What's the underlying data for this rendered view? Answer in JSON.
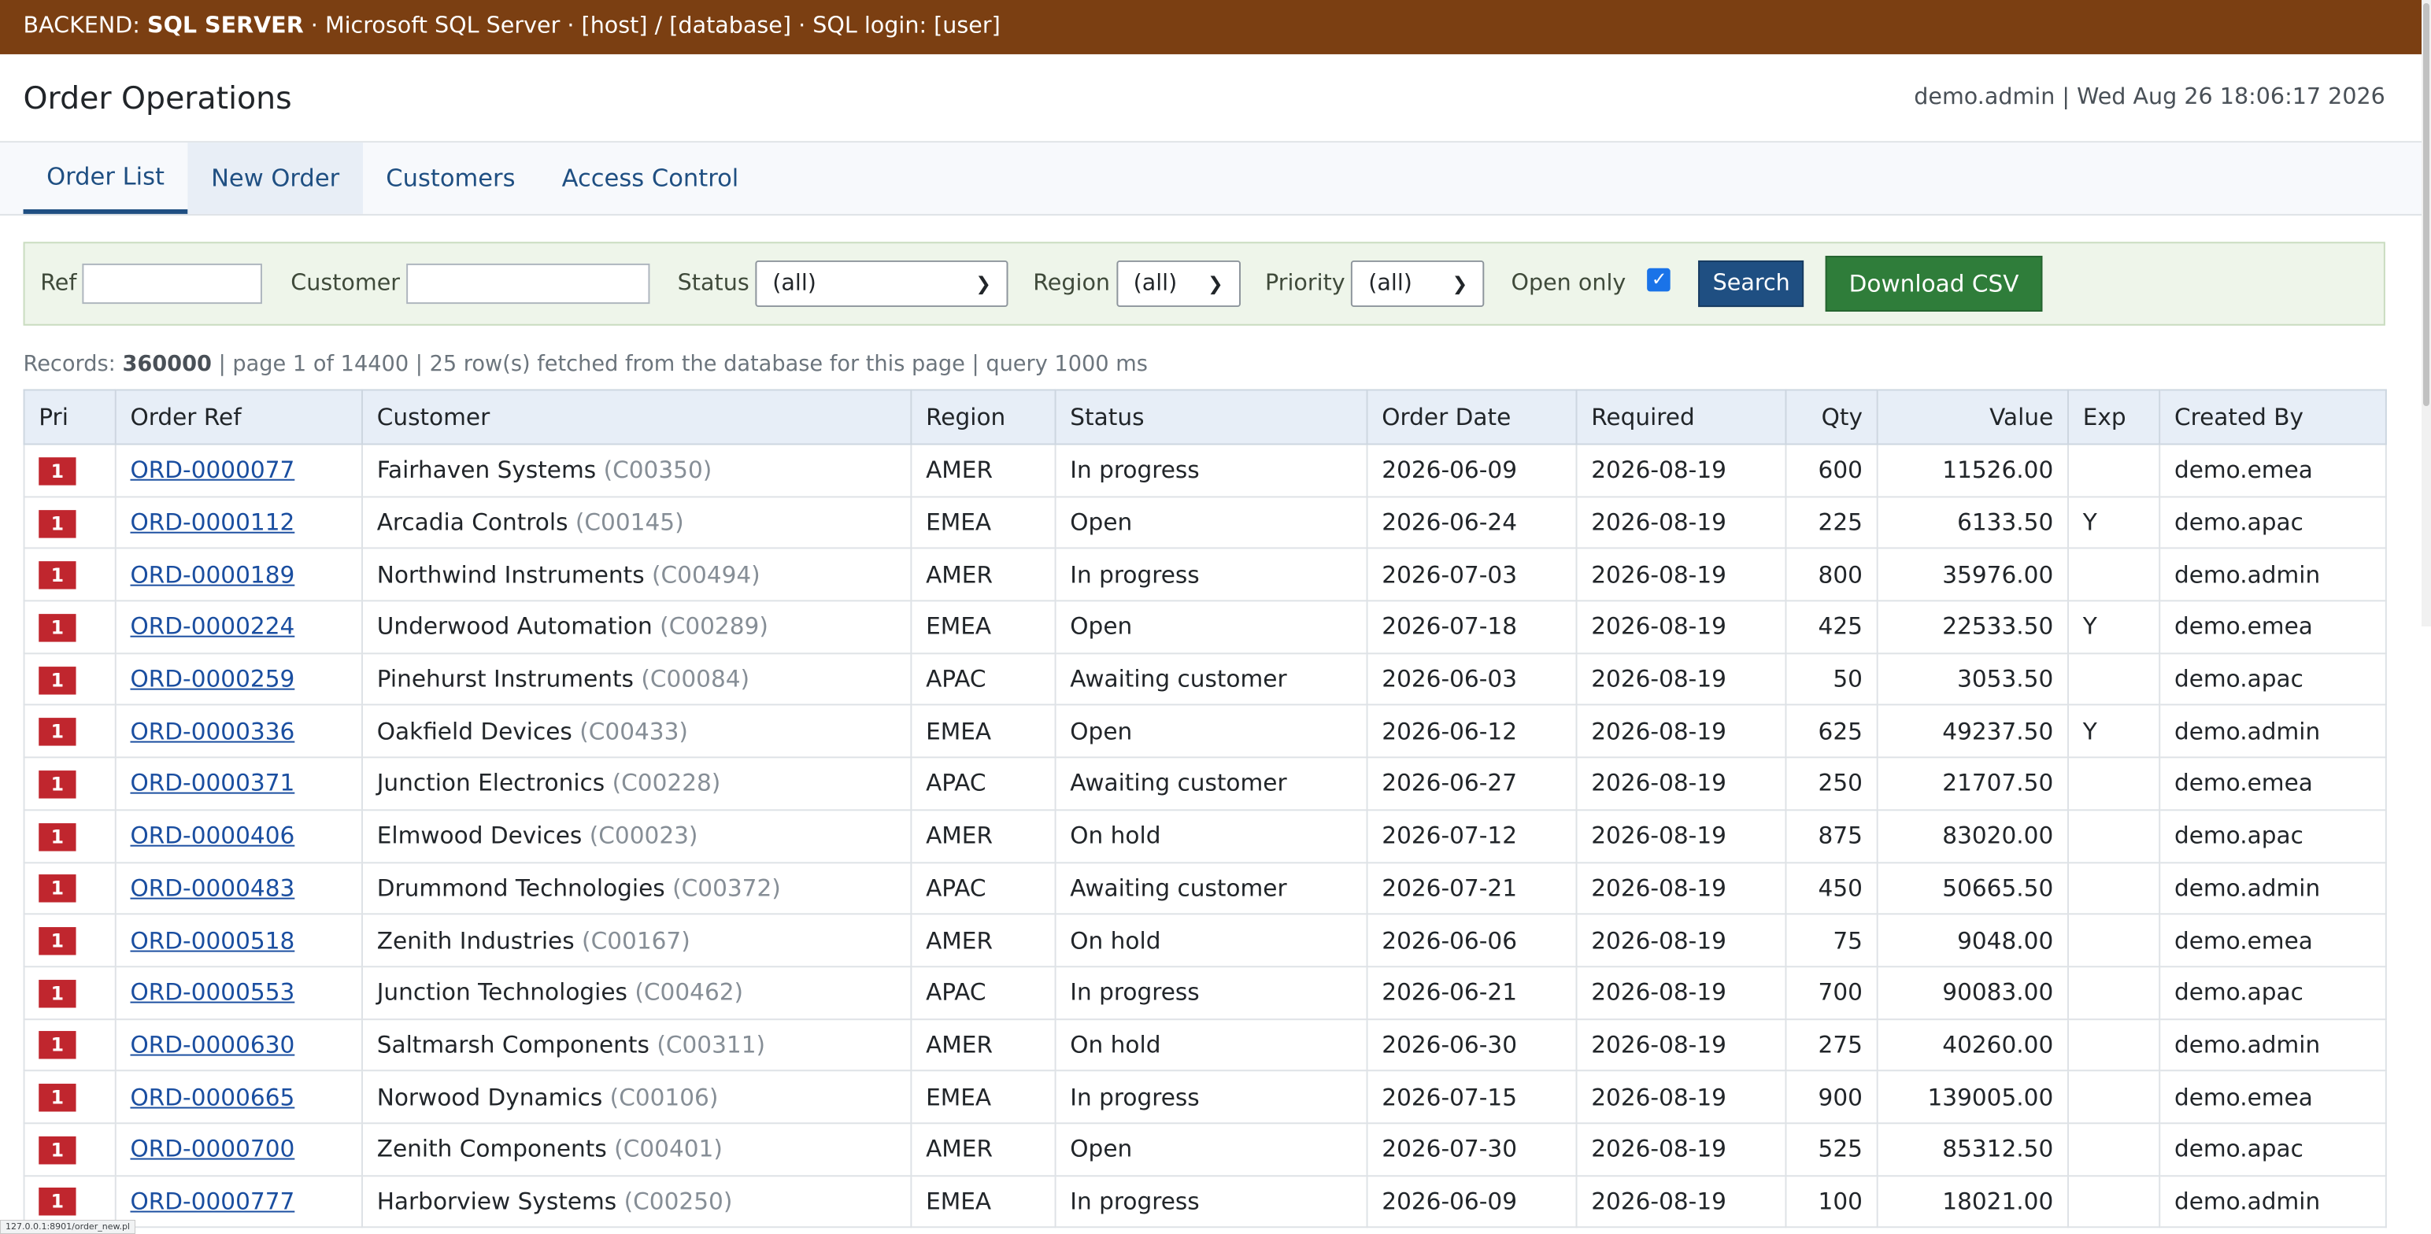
{
  "banner": {
    "prefix": "BACKEND: ",
    "backend": "SQL SERVER",
    "details": " · Microsoft SQL Server · [host] / [database] · SQL login: [user]"
  },
  "header": {
    "title": "Order Operations",
    "user_info": "demo.admin | Wed Aug 26 18:06:17 2026"
  },
  "tabs": [
    {
      "label": "Order List",
      "active": true
    },
    {
      "label": "New Order"
    },
    {
      "label": "Customers"
    },
    {
      "label": "Access Control"
    }
  ],
  "filters": {
    "ref_label": "Ref",
    "ref_value": "",
    "customer_label": "Customer",
    "customer_value": "",
    "status_label": "Status",
    "status_value": "(all)",
    "region_label": "Region",
    "region_value": "(all)",
    "priority_label": "Priority",
    "priority_value": "(all)",
    "open_only_label": "Open only",
    "open_only_checked": true,
    "search_label": "Search",
    "csv_label": "Download CSV"
  },
  "stats": {
    "records_label": "Records: ",
    "records": "360000",
    "rest": " | page 1 of 14400 | 25 row(s) fetched from the database for this page | query 1000 ms"
  },
  "table": {
    "columns": [
      "Pri",
      "Order Ref",
      "Customer",
      "Region",
      "Status",
      "Order Date",
      "Required",
      "Qty",
      "Value",
      "Exp",
      "Created By"
    ],
    "rows": [
      {
        "pri": "1",
        "ref": "ORD-0000077",
        "customer": "Fairhaven Systems",
        "cid": "(C00350)",
        "region": "AMER",
        "status": "In progress",
        "order_date": "2026-06-09",
        "required": "2026-08-19",
        "qty": "600",
        "value": "11526.00",
        "exp": "",
        "created_by": "demo.emea"
      },
      {
        "pri": "1",
        "ref": "ORD-0000112",
        "customer": "Arcadia Controls",
        "cid": "(C00145)",
        "region": "EMEA",
        "status": "Open",
        "order_date": "2026-06-24",
        "required": "2026-08-19",
        "qty": "225",
        "value": "6133.50",
        "exp": "Y",
        "created_by": "demo.apac"
      },
      {
        "pri": "1",
        "ref": "ORD-0000189",
        "customer": "Northwind Instruments",
        "cid": "(C00494)",
        "region": "AMER",
        "status": "In progress",
        "order_date": "2026-07-03",
        "required": "2026-08-19",
        "qty": "800",
        "value": "35976.00",
        "exp": "",
        "created_by": "demo.admin"
      },
      {
        "pri": "1",
        "ref": "ORD-0000224",
        "customer": "Underwood Automation",
        "cid": "(C00289)",
        "region": "EMEA",
        "status": "Open",
        "order_date": "2026-07-18",
        "required": "2026-08-19",
        "qty": "425",
        "value": "22533.50",
        "exp": "Y",
        "created_by": "demo.emea"
      },
      {
        "pri": "1",
        "ref": "ORD-0000259",
        "customer": "Pinehurst Instruments",
        "cid": "(C00084)",
        "region": "APAC",
        "status": "Awaiting customer",
        "order_date": "2026-06-03",
        "required": "2026-08-19",
        "qty": "50",
        "value": "3053.50",
        "exp": "",
        "created_by": "demo.apac"
      },
      {
        "pri": "1",
        "ref": "ORD-0000336",
        "customer": "Oakfield Devices",
        "cid": "(C00433)",
        "region": "EMEA",
        "status": "Open",
        "order_date": "2026-06-12",
        "required": "2026-08-19",
        "qty": "625",
        "value": "49237.50",
        "exp": "Y",
        "created_by": "demo.admin"
      },
      {
        "pri": "1",
        "ref": "ORD-0000371",
        "customer": "Junction Electronics",
        "cid": "(C00228)",
        "region": "APAC",
        "status": "Awaiting customer",
        "order_date": "2026-06-27",
        "required": "2026-08-19",
        "qty": "250",
        "value": "21707.50",
        "exp": "",
        "created_by": "demo.emea"
      },
      {
        "pri": "1",
        "ref": "ORD-0000406",
        "customer": "Elmwood Devices",
        "cid": "(C00023)",
        "region": "AMER",
        "status": "On hold",
        "order_date": "2026-07-12",
        "required": "2026-08-19",
        "qty": "875",
        "value": "83020.00",
        "exp": "",
        "created_by": "demo.apac"
      },
      {
        "pri": "1",
        "ref": "ORD-0000483",
        "customer": "Drummond Technologies",
        "cid": "(C00372)",
        "region": "APAC",
        "status": "Awaiting customer",
        "order_date": "2026-07-21",
        "required": "2026-08-19",
        "qty": "450",
        "value": "50665.50",
        "exp": "",
        "created_by": "demo.admin"
      },
      {
        "pri": "1",
        "ref": "ORD-0000518",
        "customer": "Zenith Industries",
        "cid": "(C00167)",
        "region": "AMER",
        "status": "On hold",
        "order_date": "2026-06-06",
        "required": "2026-08-19",
        "qty": "75",
        "value": "9048.00",
        "exp": "",
        "created_by": "demo.emea"
      },
      {
        "pri": "1",
        "ref": "ORD-0000553",
        "customer": "Junction Technologies",
        "cid": "(C00462)",
        "region": "APAC",
        "status": "In progress",
        "order_date": "2026-06-21",
        "required": "2026-08-19",
        "qty": "700",
        "value": "90083.00",
        "exp": "",
        "created_by": "demo.apac"
      },
      {
        "pri": "1",
        "ref": "ORD-0000630",
        "customer": "Saltmarsh Components",
        "cid": "(C00311)",
        "region": "AMER",
        "status": "On hold",
        "order_date": "2026-06-30",
        "required": "2026-08-19",
        "qty": "275",
        "value": "40260.00",
        "exp": "",
        "created_by": "demo.admin"
      },
      {
        "pri": "1",
        "ref": "ORD-0000665",
        "customer": "Norwood Dynamics",
        "cid": "(C00106)",
        "region": "EMEA",
        "status": "In progress",
        "order_date": "2026-07-15",
        "required": "2026-08-19",
        "qty": "900",
        "value": "139005.00",
        "exp": "",
        "created_by": "demo.emea"
      },
      {
        "pri": "1",
        "ref": "ORD-0000700",
        "customer": "Zenith Components",
        "cid": "(C00401)",
        "region": "AMER",
        "status": "Open",
        "order_date": "2026-07-30",
        "required": "2026-08-19",
        "qty": "525",
        "value": "85312.50",
        "exp": "",
        "created_by": "demo.apac"
      },
      {
        "pri": "1",
        "ref": "ORD-0000777",
        "customer": "Harborview Systems",
        "cid": "(C00250)",
        "region": "EMEA",
        "status": "In progress",
        "order_date": "2026-06-09",
        "required": "2026-08-19",
        "qty": "100",
        "value": "18021.00",
        "exp": "",
        "created_by": "demo.admin"
      }
    ]
  },
  "statusbar": {
    "url": "127.0.0.1:8901/order_new.pl"
  },
  "colors": {
    "banner": "#7b3f12",
    "priority": "#c0262e",
    "csv_button": "#2f7d3a",
    "search_button": "#1f4f82"
  }
}
